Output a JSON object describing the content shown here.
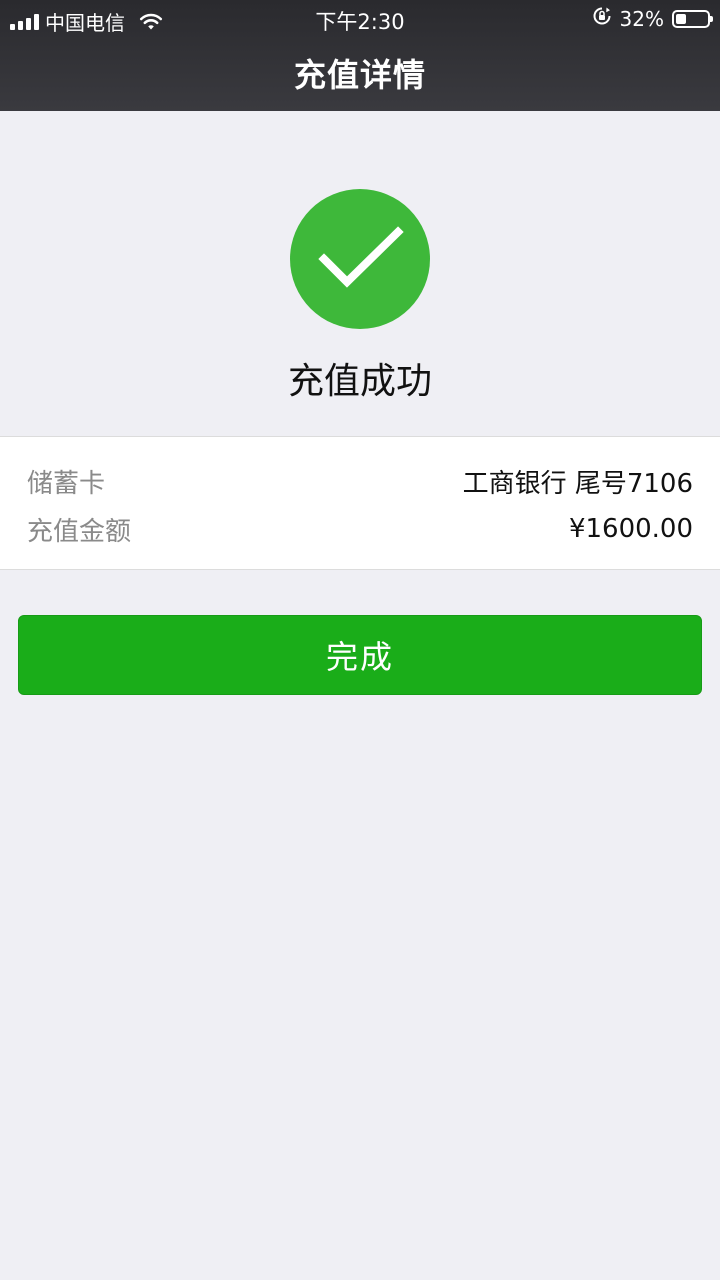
{
  "status_bar": {
    "carrier": "中国电信",
    "time": "下午2:30",
    "battery_percent": "32%",
    "battery_level": 0.32,
    "signal_icon": "signal-bars-icon",
    "wifi_icon": "wifi-icon",
    "rotation_lock_icon": "rotation-lock-icon"
  },
  "nav": {
    "title": "充值详情"
  },
  "result": {
    "icon": "check-circle-icon",
    "title": "充值成功",
    "color": "#3eb83a"
  },
  "details": [
    {
      "label": "储蓄卡",
      "value": "工商银行 尾号7106"
    },
    {
      "label": "充值金额",
      "value": "¥1600.00"
    }
  ],
  "actions": {
    "done_label": "完成",
    "color": "#1aad19"
  }
}
